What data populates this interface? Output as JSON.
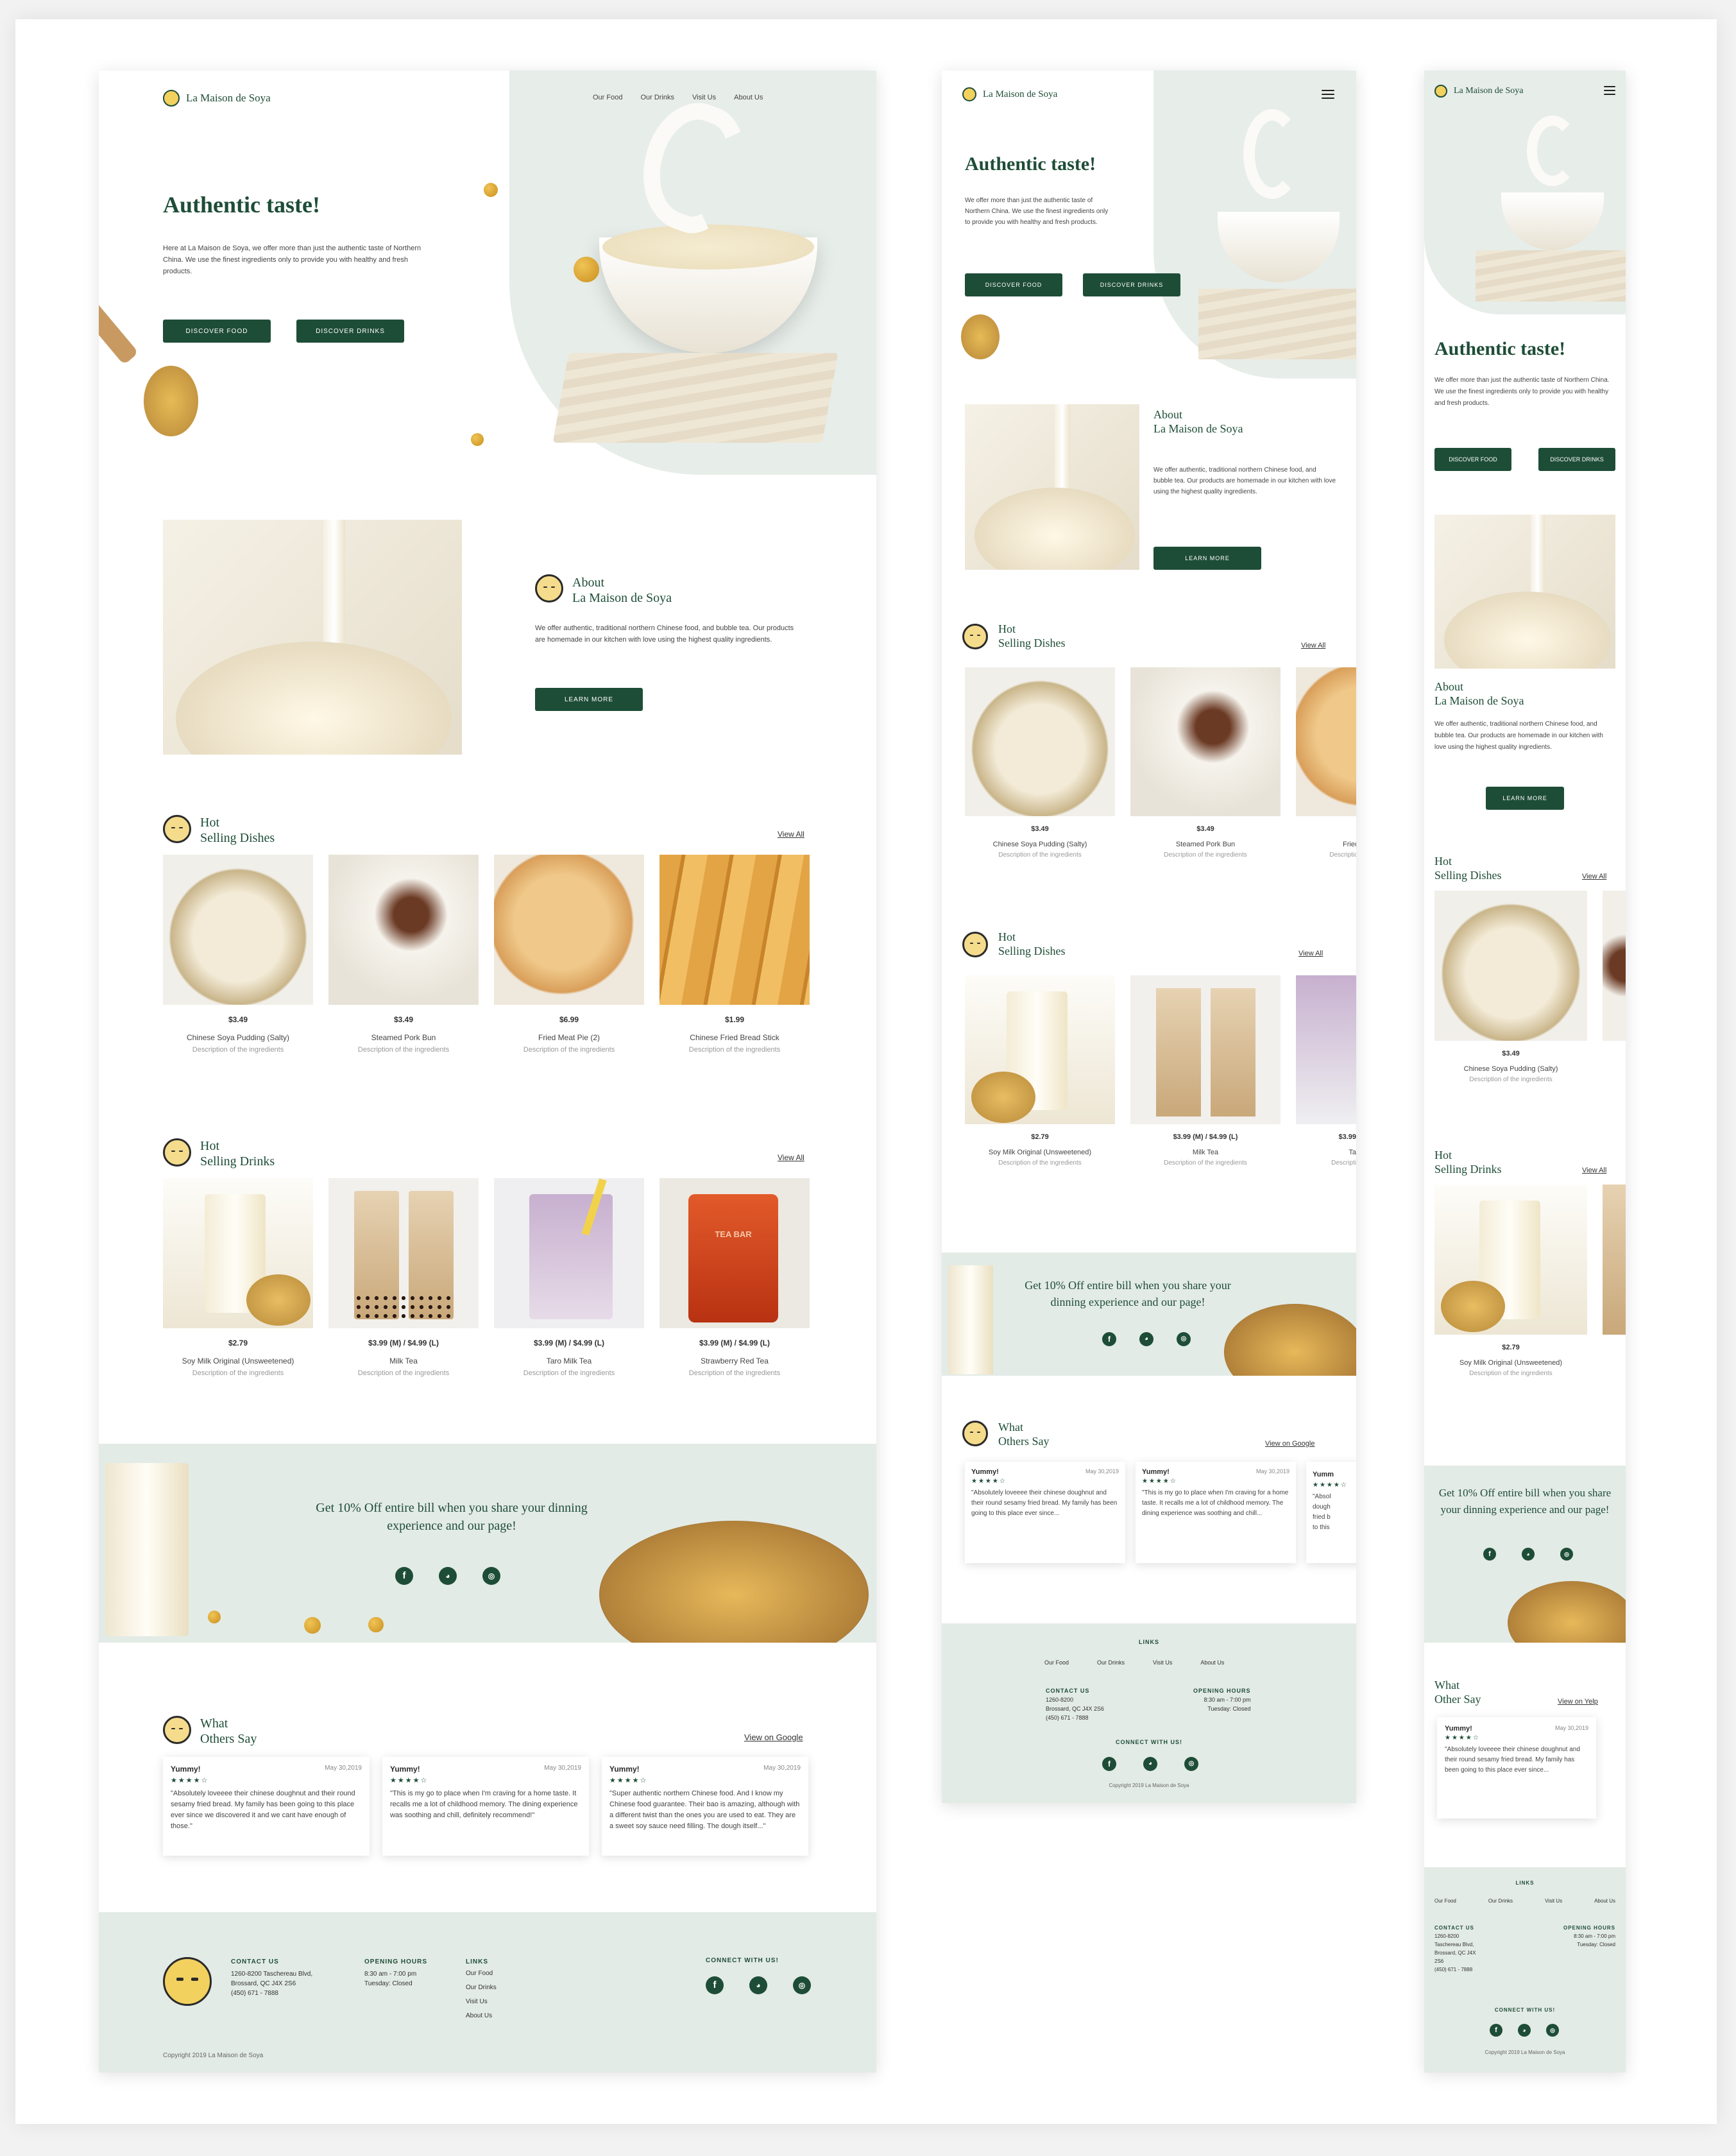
{
  "brand": {
    "name": "La Maison de Soya"
  },
  "nav": [
    "Our Food",
    "Our Drinks",
    "Visit Us",
    "About Us"
  ],
  "hero": {
    "title": "Authentic taste!",
    "body_desktop": "Here at La Maison de Soya, we offer more than just the authentic taste of Northern China. We use the finest ingredients only to provide you with healthy and fresh products.",
    "body_short": "We offer more than just the authentic taste of Northern China. We use the finest ingredients only to provide you with healthy and fresh products.",
    "btn_food": "DISCOVER FOOD",
    "btn_drinks": "DISCOVER DRINKS"
  },
  "about": {
    "line1": "About",
    "line2": "La Maison de Soya",
    "body": "We offer authentic, traditional northern Chinese food, and bubble tea. Our products are homemade in our kitchen with love using the highest quality ingredients.",
    "btn": "LEARN MORE"
  },
  "dishes": {
    "hot": "Hot",
    "title": "Selling Dishes",
    "view_all": "View All",
    "items": [
      {
        "price": "$3.49",
        "name": "Chinese Soya Pudding (Salty)",
        "desc": "Description of the ingredients"
      },
      {
        "price": "$3.49",
        "name": "Steamed Pork Bun",
        "desc": "Description of the ingredients"
      },
      {
        "price": "$6.99",
        "name": "Fried Meat Pie (2)",
        "desc": "Description of the ingredients"
      },
      {
        "price": "$1.99",
        "name": "Chinese Fried Bread Stick",
        "desc": "Description of the ingredients"
      }
    ]
  },
  "drinks": {
    "hot": "Hot",
    "title": "Selling Drinks",
    "alt_title": "Selling Dishes",
    "view_all": "View All",
    "items": [
      {
        "price": "$2.79",
        "name": "Soy Milk Original (Unsweetened)",
        "desc": "Description of the ingredients"
      },
      {
        "price": "$3.99 (M) / $4.99 (L)",
        "name": "Milk Tea",
        "desc": "Description of the ingredients"
      },
      {
        "price": "$3.99 (M) / $4.99 (L)",
        "name": "Taro Milk Tea",
        "desc": "Description of the ingredients"
      },
      {
        "price": "$3.99 (M) / $4.99 (L)",
        "name": "Strawberry Red Tea",
        "desc": "Description of the ingredients"
      }
    ],
    "tablet_fourth": {
      "price": "$3.99",
      "name": "Ta",
      "desc": "Descripti"
    }
  },
  "promo": {
    "text": "Get 10% Off entire bill when you share your dinning experience and our page!",
    "jar": "TEA BAR"
  },
  "reviews": {
    "what": "What",
    "others": "Others Say",
    "other_mobile": "Other Say",
    "view_google": "View on Google",
    "view_yelp": "View on Yelp",
    "items": [
      {
        "title": "Yummy!",
        "date": "May 30,2019",
        "stars": "★★★★☆",
        "text": "\"Absolutely loveeee their chinese doughnut and their round sesamy fried bread. My family has been going to this place ever since we discovered it and we cant have enough of those.\""
      },
      {
        "title": "Yummy!",
        "date": "May 30,2019",
        "stars": "★★★★☆",
        "text": "\"This is my go to place when I'm craving for a home taste. It recalls me a lot of childhood memory. The dining experience was soothing and chill, definitely recommend!\""
      },
      {
        "title": "Yummy!",
        "date": "May 30,2019",
        "stars": "★★★★☆",
        "text": "\"Super authentic northern Chinese food. And I know my Chinese food guarantee. Their bao is amazing, although with a different twist than the ones you are used to eat. They are a sweet soy sauce need filling. The dough itself...\""
      }
    ],
    "short1": "\"Absolutely loveeee their chinese doughnut and their round sesamy fried bread. My family has been going to this place ever since...",
    "short2": "\"This is my go to place when I'm craving for a home taste. It recalls me a lot of childhood memory. The dining experience was soothing and chill...",
    "partial": {
      "title": "Yumm",
      "text": "\"Absol dough fried b to this"
    }
  },
  "footer": {
    "contact_label": "CONTACT US",
    "address1": "1260-8200 Taschereau Blvd,",
    "address2": "Brossard, QC J4X 2S6",
    "phone": "(450) 671 - 7888",
    "m_addr_a": "1260-8200",
    "m_addr_b": "Taschereau Blvd,",
    "m_addr_c": "Brossard, QC J4X",
    "m_addr_d": "2S6",
    "hours_label": "OPENING HOURS",
    "hours1": "8:30 am - 7:00 pm",
    "hours2": "Tuesday: Closed",
    "links_label": "LINKS",
    "links": [
      "Our Food",
      "Our Drinks",
      "Visit Us",
      "About Us"
    ],
    "connect": "CONNECT WITH US!",
    "copyright": "Copyright 2019 La Maison de Soya"
  },
  "social_icons": [
    "facebook-icon",
    "wechat-icon",
    "instagram-icon"
  ],
  "colors": {
    "brand_green": "#1e4d37",
    "mint": "#e3ebe6",
    "accent_yellow": "#f2d15f"
  }
}
